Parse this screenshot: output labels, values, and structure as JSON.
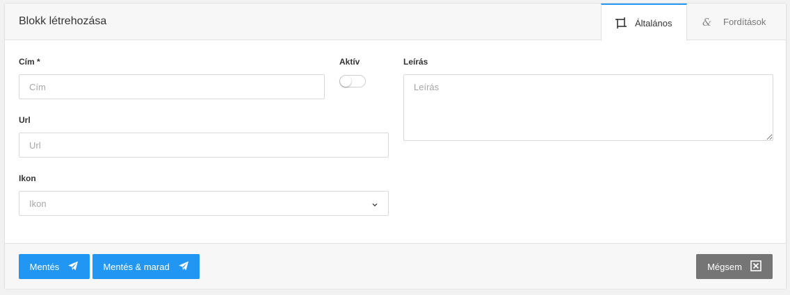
{
  "header": {
    "title": "Blokk létrehozása",
    "tabs": [
      {
        "label": "Általános",
        "icon": "crop-frame-icon",
        "active": true
      },
      {
        "label": "Fordítások",
        "icon": "ampersand-icon",
        "active": false
      }
    ]
  },
  "form": {
    "title": {
      "label": "Cím *",
      "placeholder": "Cím",
      "value": ""
    },
    "active": {
      "label": "Aktív",
      "checked": false
    },
    "description": {
      "label": "Leírás",
      "placeholder": "Leírás",
      "value": ""
    },
    "url": {
      "label": "Url",
      "placeholder": "Url",
      "value": ""
    },
    "icon": {
      "label": "Ikon",
      "placeholder": "Ikon"
    }
  },
  "footer": {
    "save_label": "Mentés",
    "save_stay_label": "Mentés & marad",
    "cancel_label": "Mégsem"
  },
  "colors": {
    "primary": "#2196f3",
    "cancel": "#757575",
    "active_tab_border": "#2196f3"
  }
}
